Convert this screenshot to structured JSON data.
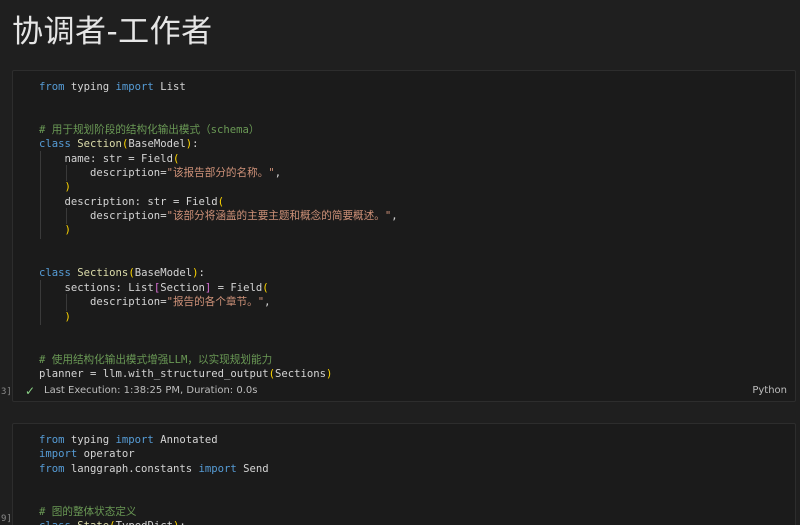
{
  "page": {
    "title": "协调者-工作者"
  },
  "cell1": {
    "exec_count": "3]",
    "lines": [
      [
        [
          "kw",
          "from"
        ],
        [
          "plain",
          " typing "
        ],
        [
          "kw",
          "import"
        ],
        [
          "plain",
          " List"
        ]
      ],
      [],
      [],
      [
        [
          "cmt",
          "# 用于规划阶段的结构化输出模式（schema）"
        ]
      ],
      [
        [
          "kw",
          "class"
        ],
        [
          "plain",
          " "
        ],
        [
          "cls",
          "Section"
        ],
        [
          "br",
          "("
        ],
        [
          "plain",
          "BaseModel"
        ],
        [
          "br",
          ")"
        ],
        [
          "plain",
          ":"
        ]
      ],
      [
        [
          "ind",
          1
        ],
        [
          "plain",
          "name: str = Field"
        ],
        [
          "br",
          "("
        ]
      ],
      [
        [
          "ind",
          2
        ],
        [
          "plain",
          "description="
        ],
        [
          "str",
          "\"该报告部分的名称。\""
        ],
        [
          "plain",
          ","
        ]
      ],
      [
        [
          "ind",
          1
        ],
        [
          "br",
          ")"
        ]
      ],
      [
        [
          "ind",
          1
        ],
        [
          "plain",
          "description: str = Field"
        ],
        [
          "br",
          "("
        ]
      ],
      [
        [
          "ind",
          2
        ],
        [
          "plain",
          "description="
        ],
        [
          "str",
          "\"该部分将涵盖的主要主题和概念的简要概述。\""
        ],
        [
          "plain",
          ","
        ]
      ],
      [
        [
          "ind",
          1
        ],
        [
          "br",
          ")"
        ]
      ],
      [],
      [],
      [
        [
          "kw",
          "class"
        ],
        [
          "plain",
          " "
        ],
        [
          "cls",
          "Sections"
        ],
        [
          "br",
          "("
        ],
        [
          "plain",
          "BaseModel"
        ],
        [
          "br",
          ")"
        ],
        [
          "plain",
          ":"
        ]
      ],
      [
        [
          "ind",
          1
        ],
        [
          "plain",
          "sections: List"
        ],
        [
          "br2",
          "["
        ],
        [
          "plain",
          "Section"
        ],
        [
          "br2",
          "]"
        ],
        [
          "plain",
          " = Field"
        ],
        [
          "br",
          "("
        ]
      ],
      [
        [
          "ind",
          2
        ],
        [
          "plain",
          "description="
        ],
        [
          "str",
          "\"报告的各个章节。\""
        ],
        [
          "plain",
          ","
        ]
      ],
      [
        [
          "ind",
          1
        ],
        [
          "br",
          ")"
        ]
      ],
      [],
      [],
      [
        [
          "cmt",
          "# 使用结构化输出模式增强LLM，以实现规划能力"
        ]
      ],
      [
        [
          "plain",
          "planner = llm.with_structured_output"
        ],
        [
          "br",
          "("
        ],
        [
          "plain",
          "Sections"
        ],
        [
          "br",
          ")"
        ]
      ]
    ],
    "status": {
      "check_icon": "✓",
      "exec_info": "Last Execution: 1:38:25 PM, Duration: 0.0s",
      "language": "Python"
    }
  },
  "cell2": {
    "exec_count": "9]",
    "lines": [
      [
        [
          "kw",
          "from"
        ],
        [
          "plain",
          " typing "
        ],
        [
          "kw",
          "import"
        ],
        [
          "plain",
          " Annotated"
        ]
      ],
      [
        [
          "kw",
          "import"
        ],
        [
          "plain",
          " operator"
        ]
      ],
      [
        [
          "kw",
          "from"
        ],
        [
          "plain",
          " langgraph.constants "
        ],
        [
          "kw",
          "import"
        ],
        [
          "plain",
          " Send"
        ]
      ],
      [],
      [],
      [
        [
          "cmt",
          "# 图的整体状态定义"
        ]
      ],
      [
        [
          "kw",
          "class"
        ],
        [
          "plain",
          " "
        ],
        [
          "cls",
          "State"
        ],
        [
          "br",
          "("
        ],
        [
          "plain",
          "TypedDict"
        ],
        [
          "br",
          ")"
        ],
        [
          "plain",
          ":"
        ]
      ]
    ]
  }
}
